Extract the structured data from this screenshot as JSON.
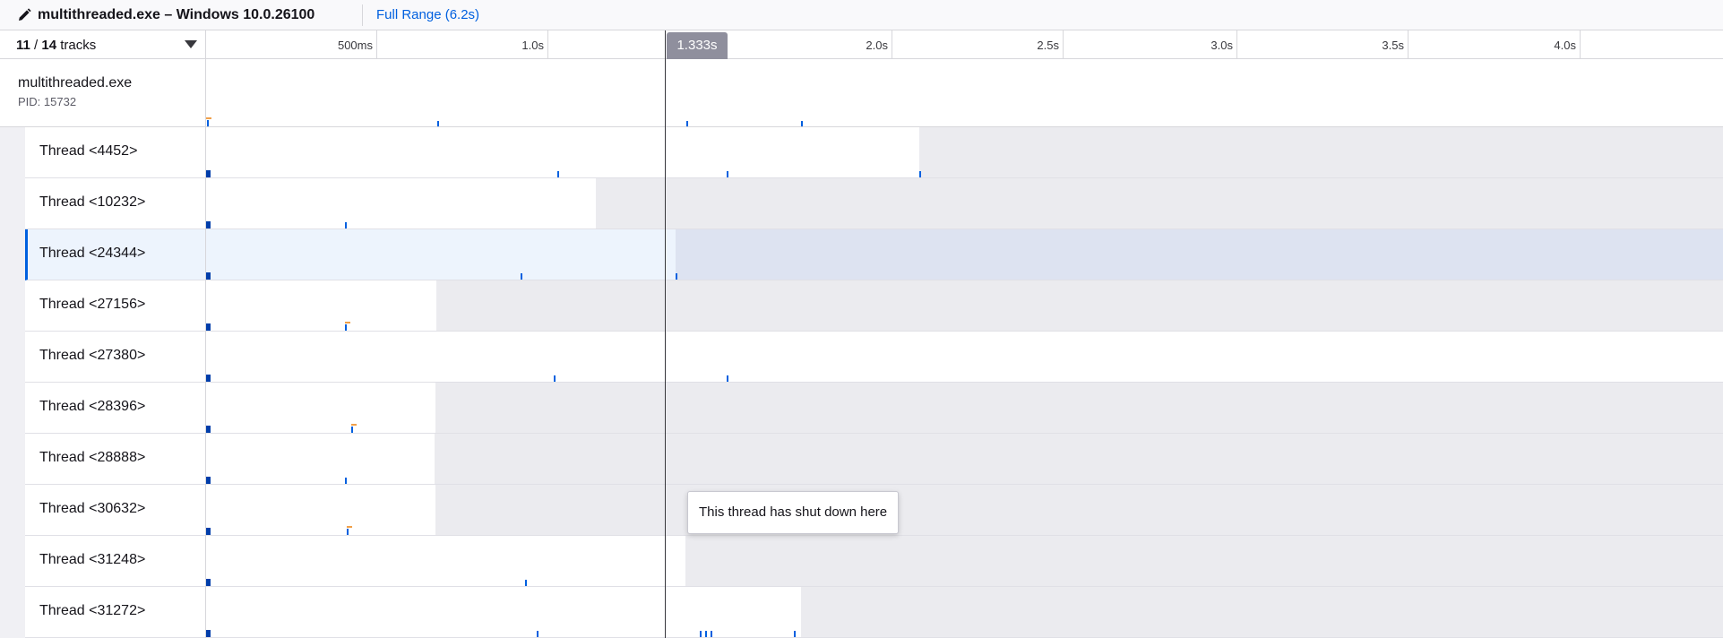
{
  "app": {
    "title": "multithreaded.exe – Windows 10.0.26100",
    "full_range_label": "Full Range (6.2s)",
    "pencil_icon": "pencil-icon"
  },
  "tracks": {
    "visible": "11",
    "total": "14",
    "suffix": "tracks",
    "menu_icon": "caret-down-icon"
  },
  "timeline": {
    "ticks": [
      "500ms",
      "1.0s",
      "2.0s",
      "2.5s",
      "3.0s",
      "3.5s",
      "4.0s"
    ],
    "hover_time": "1.333s"
  },
  "process": {
    "name": "multithreaded.exe",
    "pid": "PID: 15732"
  },
  "threads": [
    {
      "label": "Thread <4452>"
    },
    {
      "label": "Thread <10232>"
    },
    {
      "label": "Thread <24344>",
      "selected": true
    },
    {
      "label": "Thread <27156>"
    },
    {
      "label": "Thread <27380>"
    },
    {
      "label": "Thread <28396>"
    },
    {
      "label": "Thread <28888>"
    },
    {
      "label": "Thread <30632>"
    },
    {
      "label": "Thread <31248>"
    },
    {
      "label": "Thread <31272>"
    }
  ],
  "tooltip": {
    "text": "This thread has shut down here"
  },
  "colors": {
    "accent": "#0060df",
    "shutdown": "#ebebef",
    "selected": "#edf4fd"
  }
}
